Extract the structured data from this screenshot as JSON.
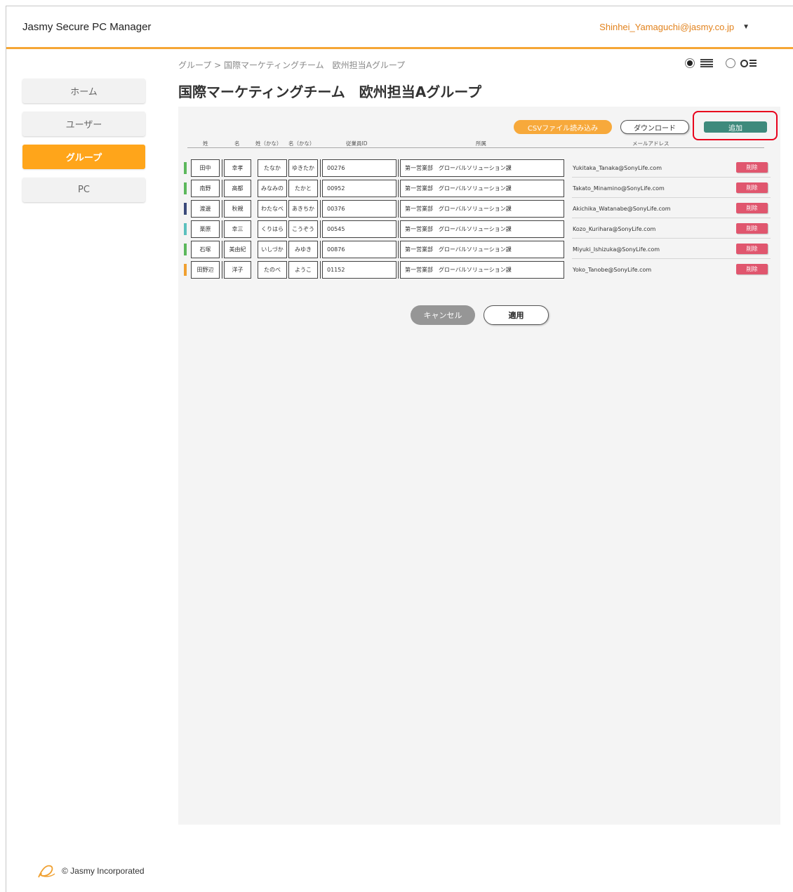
{
  "app": {
    "title": "Jasmy Secure PC Manager",
    "user_email": "Shinhei_Yamaguchi@jasmy.co.jp",
    "caret": "▼"
  },
  "sidebar": {
    "items": [
      {
        "label": "ホーム"
      },
      {
        "label": "ユーザー"
      },
      {
        "label": "グループ",
        "active": true
      },
      {
        "label": "PC"
      }
    ]
  },
  "breadcrumb": "グループ > 国際マーケティングチーム　欧州担当Aグループ",
  "page_title": "国際マーケティングチーム　欧州担当Aグループ",
  "toolbar": {
    "csv_label": "CSVファイル読み込み",
    "download_label": "ダウンロード",
    "add_label": "追加"
  },
  "table": {
    "headers": [
      "姓",
      "名",
      "姓（かな）",
      "名（かな）",
      "従業員ID",
      "所属",
      "メールアドレス"
    ],
    "rows": [
      {
        "color": "#5cb85c",
        "sei": "田中",
        "mei": "幸孝",
        "sei_kana": "たなか",
        "mei_kana": "ゆきたか",
        "id": "00276",
        "dept": "第一営業部　グローバルソリューション課",
        "email": "Yukitaka_Tanaka@SonyLife.com",
        "delete_label": "削除"
      },
      {
        "color": "#5cb85c",
        "sei": "南野",
        "mei": "高都",
        "sei_kana": "みなみの",
        "mei_kana": "たかと",
        "id": "00952",
        "dept": "第一営業部　グローバルソリューション課",
        "email": "Takato_Minamino@SonyLife.com",
        "delete_label": "削除"
      },
      {
        "color": "#3b4a7a",
        "sei": "渡邊",
        "mei": "秋親",
        "sei_kana": "わたなべ",
        "mei_kana": "あきちか",
        "id": "00376",
        "dept": "第一営業部　グローバルソリューション課",
        "email": "Akichika_Watanabe@SonyLife.com",
        "delete_label": "削除"
      },
      {
        "color": "#5bc0be",
        "sei": "栗原",
        "mei": "幸三",
        "sei_kana": "くりはら",
        "mei_kana": "こうぞう",
        "id": "00545",
        "dept": "第一営業部　グローバルソリューション課",
        "email": "Kozo_Kurihara@SonyLife.com",
        "delete_label": "削除"
      },
      {
        "color": "#5cb85c",
        "sei": "石塚",
        "mei": "美由紀",
        "sei_kana": "いしづか",
        "mei_kana": "みゆき",
        "id": "00876",
        "dept": "第一営業部　グローバルソリューション課",
        "email": "Miyuki_Ishizuka@SonyLife.com",
        "delete_label": "削除"
      },
      {
        "color": "#f0a030",
        "sei": "田野辺",
        "mei": "洋子",
        "sei_kana": "たのべ",
        "mei_kana": "ようこ",
        "id": "01152",
        "dept": "第一営業部　グローバルソリューション課",
        "email": "Yoko_Tanobe@SonyLife.com",
        "delete_label": "削除"
      }
    ]
  },
  "actions": {
    "cancel_label": "キャンセル",
    "apply_label": "適用"
  },
  "footer": {
    "copyright": "© Jasmy Incorporated"
  }
}
